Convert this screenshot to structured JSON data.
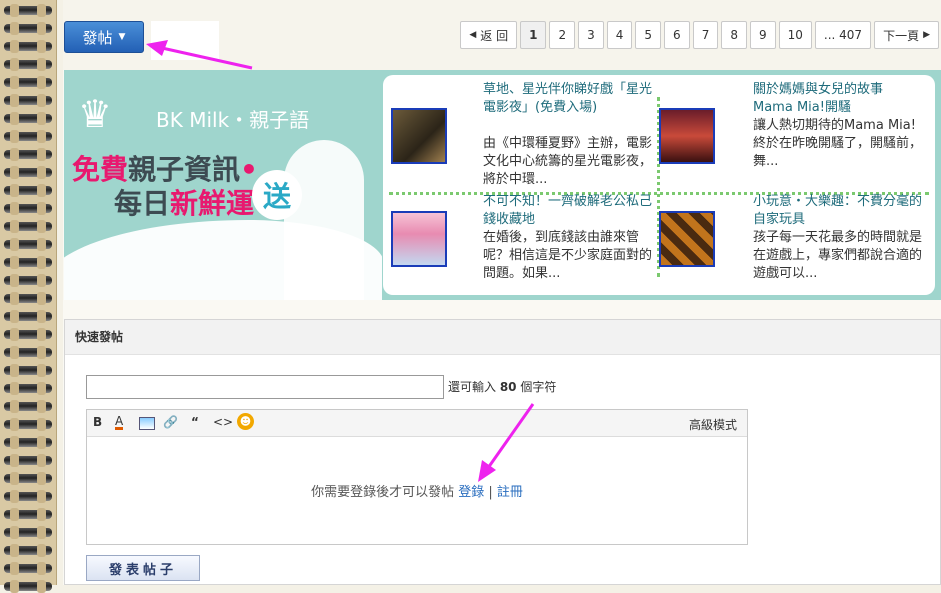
{
  "post_button": {
    "label": "發帖"
  },
  "pager": {
    "prev": "返 回",
    "pages": [
      "1",
      "2",
      "3",
      "4",
      "5",
      "6",
      "7",
      "8",
      "9",
      "10"
    ],
    "last": "... 407",
    "next": "下一頁"
  },
  "banner": {
    "brand": "BK Milk・親子語",
    "slogan_free": "免費",
    "slogan_rest": "親子資訊",
    "slogan_daily": "每日",
    "slogan_fresh": "新鮮運",
    "slogan_send": "送"
  },
  "articles": [
    {
      "title": "草地、星光伴你睇好戲「星光電影夜」(免費入場)",
      "desc": "由《中環種夏野》主辦，電影文化中心統籌的星光電影夜，將於中環..."
    },
    {
      "title": "關於媽媽與女兒的故事 Mama Mia!開騷",
      "desc": "讓人熱切期待的Mama Mia!終於在昨晚開騷了，開騷前，舞..."
    },
    {
      "title": "不可不知！一齊破解老公私己錢收藏地",
      "desc": "在婚後，到底錢該由誰來管呢？相信這是不少家庭面對的問題。如果..."
    },
    {
      "title": "小玩意・大樂趣：不費分毫的自家玩具",
      "desc": "孩子每一天花最多的時間就是在遊戲上，專家們都說合適的遊戲可以..."
    }
  ],
  "quick_post": {
    "heading": "快速發帖",
    "limit_prefix": "還可輸入 ",
    "limit_count": "80",
    "limit_suffix": " 個字符",
    "advanced": "高級模式",
    "login_msg": "你需要登錄後才可以發帖 ",
    "login": "登錄",
    "sep": " | ",
    "register": "註冊",
    "submit": "發表帖子"
  },
  "colors": {
    "accent": "#2360b5",
    "arrow": "#ee22ee",
    "banner": "#9fd5cd",
    "link": "#1e6b7b"
  }
}
